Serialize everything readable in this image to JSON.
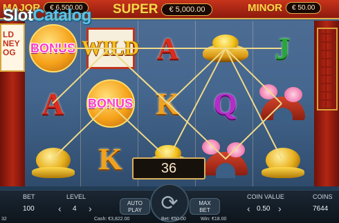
{
  "jackpots": {
    "major": {
      "label": "MAJOR",
      "value": "€ 6,500.00"
    },
    "super": {
      "label": "SUPER",
      "value": "€ 5,000.00"
    },
    "minor": {
      "label": "MINOR",
      "value": "€ 50.00"
    }
  },
  "watermark": {
    "part1": "Slot",
    "part2": "Catalog"
  },
  "logo": {
    "line1": "LD",
    "line2": "NEY",
    "line3": "OG"
  },
  "reels": [
    [
      "BONUS",
      "A",
      "ingot-toad"
    ],
    [
      "WILD",
      "BONUS",
      "K"
    ],
    [
      "A",
      "K",
      "gold-ingot"
    ],
    [
      "gold-ingot",
      "Q",
      "bridge-blossom"
    ],
    [
      "J",
      "bridge-blossom",
      "ingot-toad"
    ]
  ],
  "win_amount": "36",
  "hud": {
    "bet_label": "BET",
    "bet_value": "100",
    "level_label": "LEVEL",
    "level_value": "4",
    "autoplay_line1": "AUTO",
    "autoplay_line2": "PLAY",
    "maxbet_line1": "MAX",
    "maxbet_line2": "BET",
    "coin_value_label": "COIN VALUE",
    "coin_value_value": "0.50",
    "coins_label": "COINS",
    "coins_value": "7644",
    "cash": "Cash: €3,822.00",
    "bet_footer": "Bet: €50.00",
    "win_footer": "Win: €18.00",
    "left_corner": "32"
  },
  "colors": {
    "accent_gold": "#e0b24a",
    "jackpot_red": "#c7341b",
    "bonus_pink": "#ff3cc4",
    "payline": "#f0d98a"
  }
}
